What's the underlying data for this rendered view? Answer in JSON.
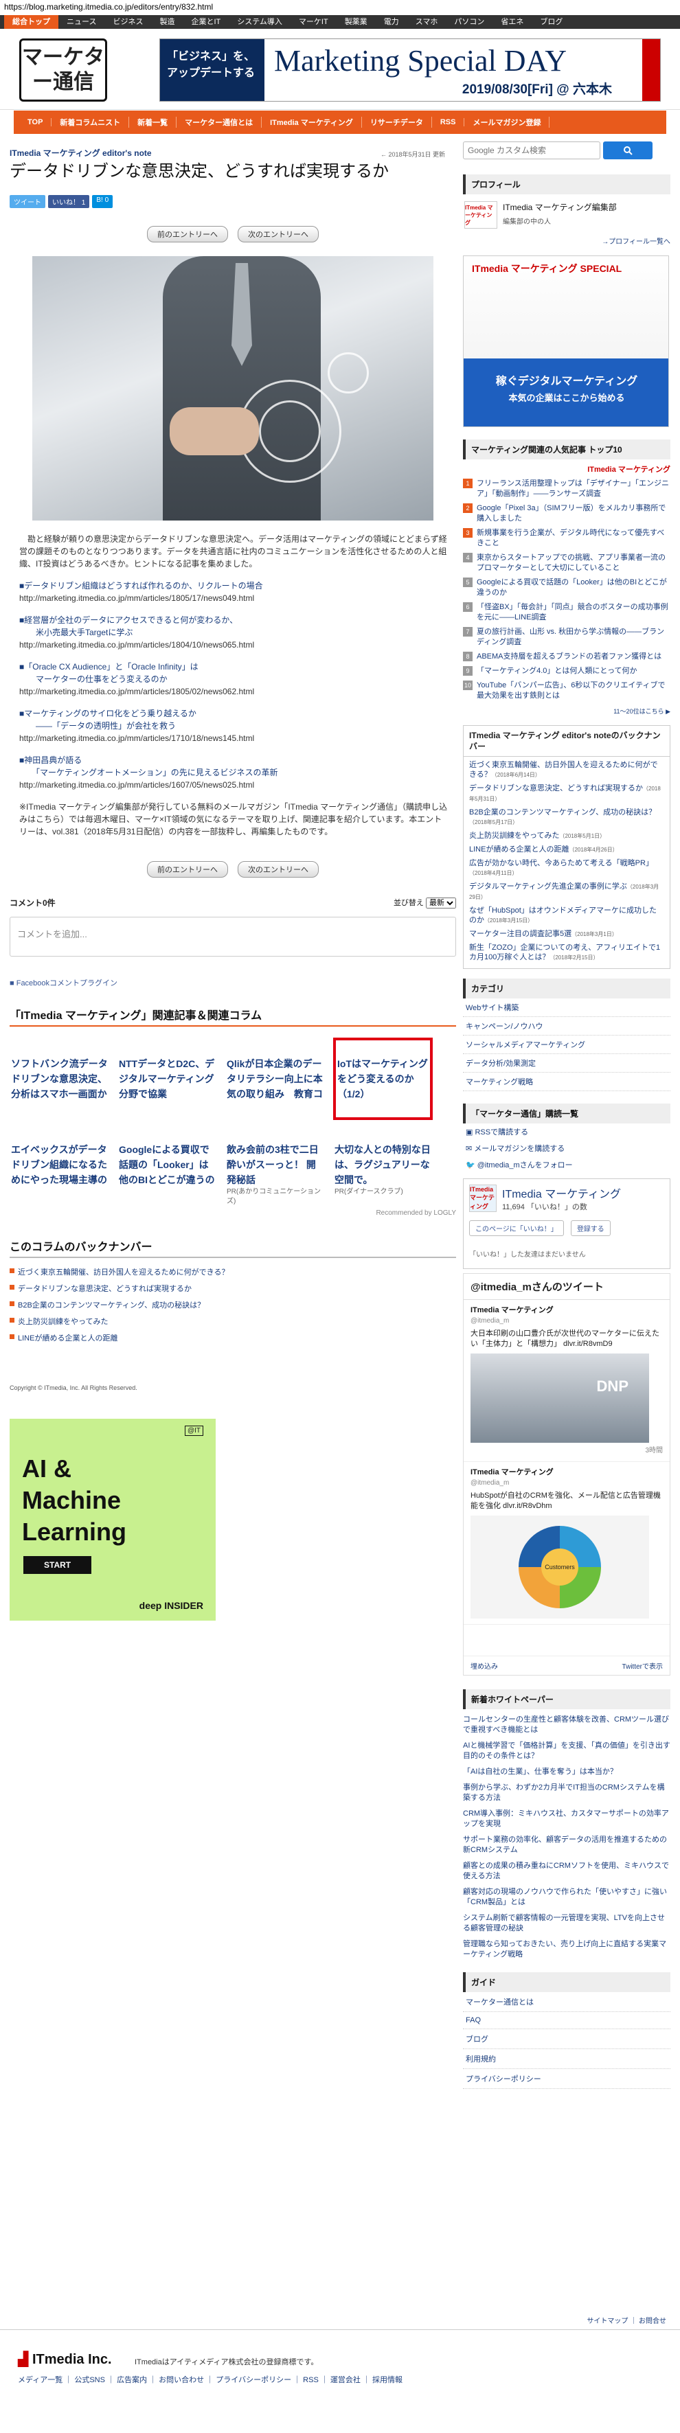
{
  "url": "https://blog.marketing.itmedia.co.jp/editors/entry/832.html",
  "topnav": [
    "総合トップ",
    "ニュース",
    "ビジネス",
    "製造",
    "企業とIT",
    "システム導入",
    "マーケIT",
    "製薬業",
    "電力",
    "スマホ",
    "パソコン",
    "省エネ",
    "ブログ"
  ],
  "logo_text": "マーケター通信",
  "banner": {
    "left": "「ビジネス」を、アップデートする",
    "title": "Marketing Special DAY",
    "date": "2019/08/30[Fri] @ 六本木"
  },
  "orange_nav": [
    "TOP",
    "新着コラムニスト",
    "新着一覧",
    "マーケター通信とは",
    "ITmedia マーケティング",
    "リサーチデータ",
    "RSS",
    "メールマガジン登録"
  ],
  "article": {
    "series": "ITmedia マーケティング editor's note",
    "updated": "← 2018年5月31日 更新",
    "title": "データドリブンな意思決定、どうすれば実現するか",
    "share": {
      "tweet": "ツイート",
      "like": "いいね！ 1",
      "hatena": "B! 0"
    },
    "prev": "前のエントリーへ",
    "next": "次のエントリーへ",
    "body": "勘と経験が頼りの意思決定からデータドリブンな意思決定へ。データ活用はマーケティングの領域にとどまらず経営の課題そのものとなりつつあります。データを共通言語に社内のコミュニケーションを活性化させるための人と組織、IT投資はどうあるべきか。ヒントになる記事を集めました。",
    "links": [
      {
        "t": "■データドリブン組織はどうすれば作れるのか、リクルートの場合",
        "u": "http://marketing.itmedia.co.jp/mm/articles/1805/17/news049.html"
      },
      {
        "t": "■経営層が全社のデータにアクセスできると何が変わるか、\n　　米小売最大手Targetに学ぶ",
        "u": "http://marketing.itmedia.co.jp/mm/articles/1804/10/news065.html"
      },
      {
        "t": "■「Oracle CX Audience」と「Oracle Infinity」は\n　　マーケターの仕事をどう変えるのか",
        "u": "http://marketing.itmedia.co.jp/mm/articles/1805/02/news062.html"
      },
      {
        "t": "■マーケティングのサイロ化をどう乗り越えるか\n　　――「データの透明性」が会社を救う",
        "u": "http://marketing.itmedia.co.jp/mm/articles/1710/18/news145.html"
      },
      {
        "t": "■神田昌典が語る\n　　「マーケティングオートメーション」の先に見えるビジネスの革新",
        "u": "http://marketing.itmedia.co.jp/mm/articles/1607/05/news025.html"
      }
    ],
    "note": "※ITmedia マーケティング編集部が発行している無料のメールマガジン「ITmedia マーケティング通信」（購読申し込みはこちら）では毎週木曜日、マーケ×IT領域の気になるテーマを取り上げ、関連記事を紹介しています。本エントリーは、vol.381（2018年5月31日配信）の内容を一部抜粋し、再編集したものです。"
  },
  "comments": {
    "count": "コメント0件",
    "sort_label": "並び替え",
    "sort_value": "最新",
    "placeholder": "コメントを追加...",
    "plugin": "Facebookコメントプラグイン"
  },
  "related": {
    "title": "「ITmedia マーケティング」関連記事＆関連コラム",
    "row1": [
      "ソフトバンク流データドリブンな意思決定、分析はスマホ一画面か",
      "NTTデータとD2C、デジタルマーケティング分野で協業",
      "Qlikが日本企業のデータリテラシー向上に本気の取り組み　教育コ",
      "IoTはマーケティングをどう変えるのか（1/2）"
    ],
    "row2": [
      {
        "t": "エイベックスがデータドリブン組織になるためにやった現場主導の",
        "pr": ""
      },
      {
        "t": "Googleによる買収で話題の「Looker」は他のBIとどこが違うの",
        "pr": ""
      },
      {
        "t": "飲み会前の3柱で二日酔いがスーっと！ 開発秘話",
        "pr": "PR(あかりコミュニケーションズ)"
      },
      {
        "t": "大切な人との特別な日は、ラグジュアリーな空間で。",
        "pr": "PR(ダイナースクラブ)"
      }
    ],
    "recommended": "Recommended by LOGLY"
  },
  "backnumber": {
    "title": "このコラムのバックナンバー",
    "items": [
      "近づく東京五輪開催、訪日外国人を迎えるために何ができる？",
      "データドリブンな意思決定、どうすれば実現するか",
      "B2B企業のコンテンツマーケティング、成功の秘訣は？",
      "炎上防災訓練をやってみた",
      "LINEが績める企業と人の距離"
    ]
  },
  "copyright": "Copyright © ITmedia, Inc. All Rights Reserved.",
  "ad_bottom": {
    "title": "AI &\nMachine\nLearning",
    "start": "START",
    "brand": "deep INSIDER",
    "logo": "@IT"
  },
  "sidebar": {
    "search_placeholder": "Google カスタム検索",
    "profile_h": "プロフィール",
    "profile_name": "ITmedia マーケティング編集部",
    "profile_desc": "編集部の中の人",
    "profile_logo": "ITmedia マーケティング",
    "profile_more": "→プロフィール一覧へ",
    "ad1": {
      "logo": "ITmedia マーケティング SPECIAL",
      "a": "稼ぐデジタルマーケティング",
      "b": "本気の企業はここから始める"
    },
    "ranking_h": "マーケティング関連の人気記事 トップ10",
    "ranking_logo": "ITmedia マーケティング",
    "ranking": [
      "フリーランス活用整理トップは「デザイナー」「エンジニア」「動画制作」――ランサーズ調査",
      "Google「Pixel 3a」（SIMフリー版）をメルカリ事務所で購入しました",
      "新規事業を行う企業が、デジタル時代になって優先すべきこと",
      "東京からスタートアップでの挑戦、アプリ事業者一流のプロマーケターとして大切にしていること",
      "Googleによる買収で話題の「Looker」は他のBIとどこが違うのか",
      "「怪盗BX」「毎会計」「同点」競合のボスターの成功事例を元に――LINE調査",
      "夏の旅行計画、山形 vs. 秋田から学ぶ情報の――ブランディング調査",
      "ABEMA支持層を超えるブランドの若者ファン獲得とは",
      "「マーケティング4.0」とは何人類にとって何か",
      "YouTube「バンパー広告」、6秒以下のクリエイティブで最大効果を出す鉄則とは"
    ],
    "ranking_foot": "11～20位はこちら ▶",
    "editor_h": "ITmedia マーケティング editor's noteのバックナンバー",
    "editor_items": [
      {
        "t": "近づく東京五輪開催、訪日外国人を迎えるために何ができる？",
        "d": "（2018年6月14日）"
      },
      {
        "t": "データドリブンな意思決定、どうすれば実現するか",
        "d": "（2018年5月31日）"
      },
      {
        "t": "B2B企業のコンテンツマーケティング、成功の秘訣は？",
        "d": "（2018年5月17日）"
      },
      {
        "t": "炎上防災訓練をやってみた",
        "d": "（2018年5月1日）"
      },
      {
        "t": "LINEが績める企業と人の距離",
        "d": "（2018年4月26日）"
      },
      {
        "t": "広告が効かない時代、今あらためて考える「戦略PR」",
        "d": "（2018年4月11日）"
      },
      {
        "t": "デジタルマーケティング先進企業の事例に学ぶ",
        "d": "（2018年3月29日）"
      },
      {
        "t": "なぜ「HubSpot」はオウンドメディアマーケに成功したのか",
        "d": "（2018年3月15日）"
      },
      {
        "t": "マーケター注目の調査記事5選",
        "d": "（2018年3月1日）"
      },
      {
        "t": "新生「ZOZO」企業についての考え、アフィリエイトで1カ月100万稼ぐ人とは？",
        "d": "（2018年2月15日）"
      }
    ],
    "cat_h": "カテゴリ",
    "cats": [
      "Webサイト構築",
      "キャンペーン/ノウハウ",
      "ソーシャルメディアマーケティング",
      "データ分析/効果測定",
      "マーケティング戦略"
    ],
    "sub_h": "「マーケター通信」購読一覧",
    "subs": [
      "RSSで購読する",
      "メールマガジンを購読する",
      "@itmedia_mさんをフォロー"
    ],
    "fb": {
      "name": "ITmedia マーケティング",
      "likes": "11,694 「いいね！」の数",
      "btn1": "このページに「いいね！」",
      "btn2": "登録する",
      "empty": "「いいね！」した友達はまだいません"
    },
    "tw": {
      "h": "@itmedia_mさんのツイート",
      "user": "ITmedia マーケティング",
      "handle": "@itmedia_m",
      "text1": "大日本印刷の山口豊介氏が次世代のマーケターに伝えたい「主体力」と「構想力」 dlvr.it/R8vmD9",
      "img1": "DNP",
      "meta": "3時間",
      "text2": "HubSpotが自社のCRMを強化、メール配信と広告管理機能を強化 dlvr.it/R8vDhm",
      "ring": "Customers",
      "embed": "埋め込み",
      "view": "Twitterで表示"
    },
    "wp_h": "新着ホワイトペーパー",
    "wp": [
      "コールセンターの生産性と顧客体験を改善、CRMツール選びで重視すべき機能とは",
      "AIと機械学習で「価格計算」を支援、「真の価値」を引き出す目的のその条件とは？",
      "「AIは自社の生業」、仕事を奪う」は本当か？",
      "事例から学ぶ、わずか2カ月半でIT担当のCRMシステムを構築する方法",
      "CRM導入事例：ミキハウス社、カスタマーサポートの効率アップを実現",
      "サポート業務の効率化、顧客データの活用を推進するための新CRMシステム",
      "顧客との成果の積み重ねにCRMソフトを使用、ミキハウスで使える方法",
      "顧客対応の現場のノウハウで作られた「使いやすさ」に強い「CRM製品」とは",
      "システム刷新で顧客情報の一元管理を実現、LTVを向上させる顧客管理の秘訣",
      "管理職なら知っておきたい、売り上げ向上に直結する実業マーケティング戦略"
    ],
    "guide_h": "ガイド",
    "guide": [
      "マーケター通信とは",
      "FAQ",
      "ブログ",
      "利用規約",
      "プライバシーポリシー"
    ]
  },
  "footer": {
    "sitemap": "サイトマップ ｜ お問合せ",
    "company": "ITmedia Inc.",
    "text": "ITmediaはアイティメディア株式会社の登録商標です。",
    "links": "メディア一覧 ｜ 公式SNS ｜ 広告案内 ｜ お問い合わせ ｜ プライバシーポリシー ｜ RSS ｜ 運営会社 ｜ 採用情報"
  }
}
